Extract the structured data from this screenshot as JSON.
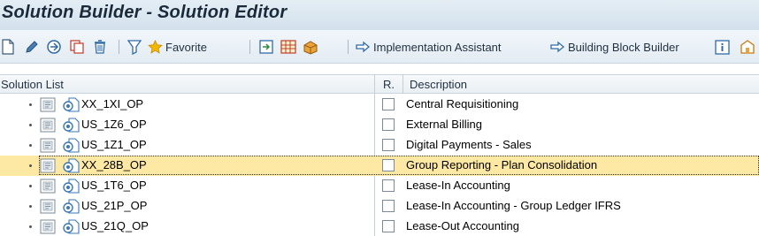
{
  "window": {
    "title": "Solution Builder - Solution Editor"
  },
  "toolbar": {
    "favorite_label": "Favorite",
    "implementation_assistant_label": "Implementation Assistant",
    "building_block_builder_label": "Building Block Builder"
  },
  "table": {
    "col_solution_list": "Solution List",
    "col_r": "R.",
    "col_description": "Description",
    "rows": [
      {
        "name": "XX_1XI_OP",
        "description": "Central Requisitioning",
        "selected": false
      },
      {
        "name": "US_1Z6_OP",
        "description": "External Billing",
        "selected": false
      },
      {
        "name": "US_1Z1_OP",
        "description": "Digital Payments - Sales",
        "selected": false
      },
      {
        "name": "XX_28B_OP",
        "description": "Group Reporting - Plan Consolidation",
        "selected": true
      },
      {
        "name": "US_1T6_OP",
        "description": "Lease-In Accounting",
        "selected": false
      },
      {
        "name": "US_21P_OP",
        "description": "Lease-In Accounting - Group Ledger IFRS",
        "selected": false
      },
      {
        "name": "US_21Q_OP",
        "description": "Lease-Out Accounting",
        "selected": false
      }
    ]
  },
  "colors": {
    "selected_row": "#fde9a4",
    "accent": "#e6a300",
    "icon_blue": "#3a78b8"
  }
}
